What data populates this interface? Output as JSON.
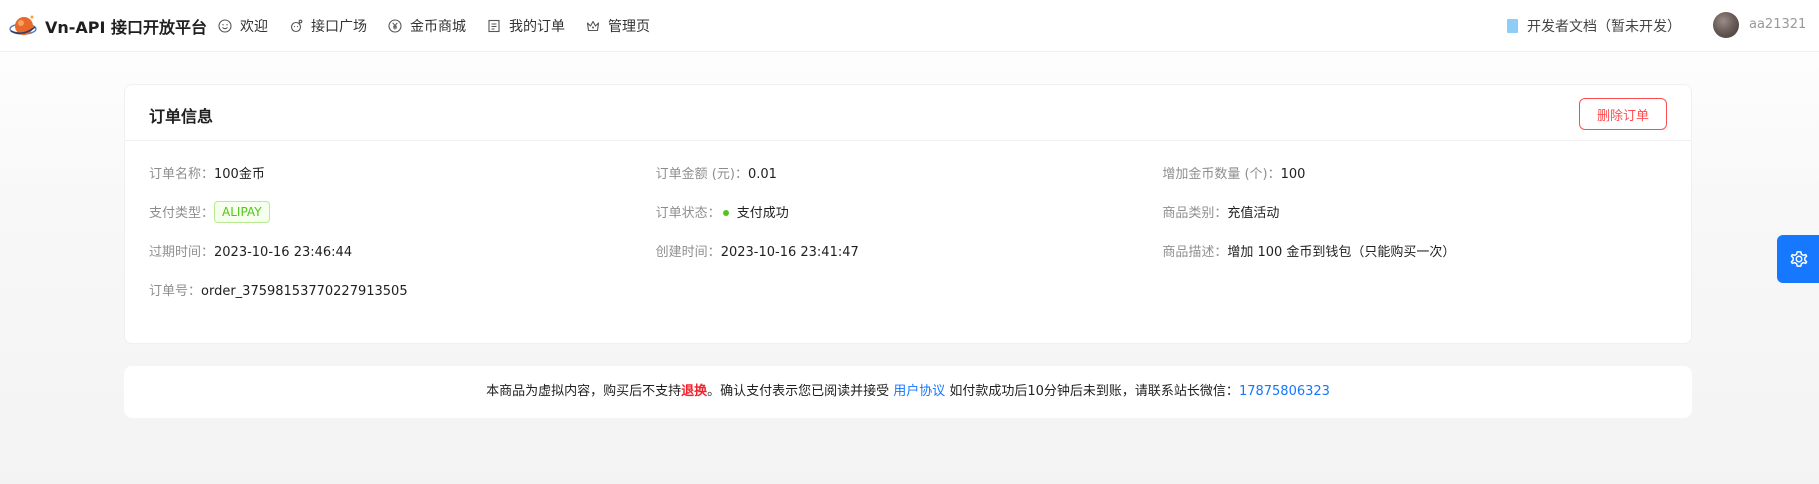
{
  "header": {
    "brand": "Vn-API 接口开放平台",
    "nav": [
      {
        "label": "欢迎",
        "icon": "smile-icon"
      },
      {
        "label": "接口广场",
        "icon": "api-icon"
      },
      {
        "label": "金币商城",
        "icon": "coin-icon"
      },
      {
        "label": "我的订单",
        "icon": "order-icon"
      },
      {
        "label": "管理页",
        "icon": "crown-icon"
      }
    ],
    "docs_label": "开发者文档（暂未开发）",
    "username": "aa21321"
  },
  "card": {
    "title": "订单信息",
    "delete_label": "删除订单",
    "rows": [
      [
        {
          "label": "订单名称：",
          "value": "100金币"
        },
        {
          "label": "订单金额 (元)：",
          "value": "0.01"
        },
        {
          "label": "增加金币数量 (个)：",
          "value": "100"
        }
      ],
      [
        {
          "label": "支付类型：",
          "value": "ALIPAY",
          "kind": "tag"
        },
        {
          "label": "订单状态：",
          "value": "支付成功",
          "kind": "status"
        },
        {
          "label": "商品类别：",
          "value": "充值活动"
        }
      ],
      [
        {
          "label": "过期时间：",
          "value": "2023-10-16 23:46:44"
        },
        {
          "label": "创建时间：",
          "value": "2023-10-16 23:41:47"
        },
        {
          "label": "商品描述：",
          "value": "增加 100 金币到钱包（只能购买一次）"
        }
      ],
      [
        {
          "label": "订单号：",
          "value": "order_37598153770227913505"
        }
      ]
    ]
  },
  "notice": {
    "prefix": "本商品为虚拟内容，购买后不支持",
    "highlight": "退换",
    "middle": "。确认支付表示您已阅读并接受 ",
    "link_label": "用户协议",
    "suffix": " 如付款成功后10分钟后未到账，请联系站长微信：",
    "wechat": "17875806323"
  },
  "colors": {
    "primary": "#1677ff",
    "danger": "#ff4d4f",
    "success": "#52c41a"
  },
  "float_button_icon": "gear-icon"
}
